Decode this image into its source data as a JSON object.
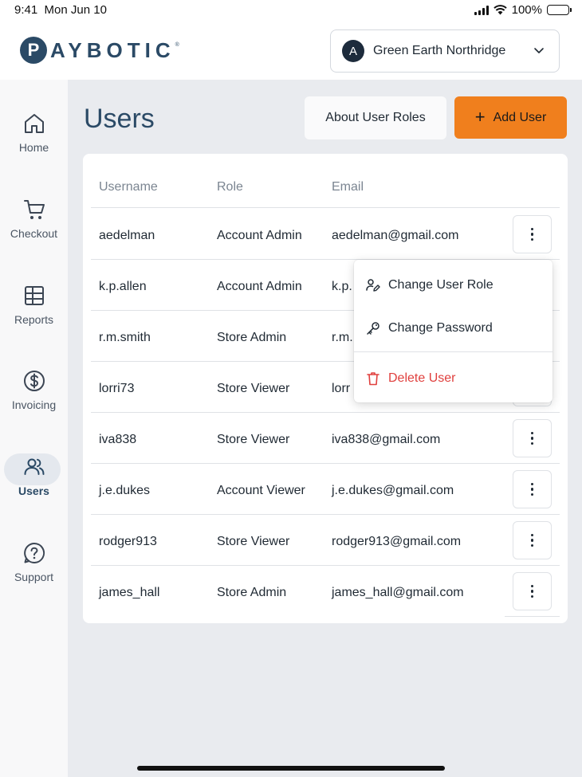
{
  "status_bar": {
    "time": "9:41",
    "date": "Mon Jun 10",
    "battery": "100%"
  },
  "brand": {
    "logo_letter": "P",
    "logo_text": "AYBOTIC",
    "logo_mark": "®",
    "color": "#2b4a66"
  },
  "store_selector": {
    "avatar_letter": "A",
    "store_name": "Green Earth Northridge"
  },
  "sidebar": {
    "items": [
      {
        "label": "Home",
        "icon": "home-icon"
      },
      {
        "label": "Checkout",
        "icon": "cart-icon"
      },
      {
        "label": "Reports",
        "icon": "table-icon"
      },
      {
        "label": "Invoicing",
        "icon": "dollar-circle-icon"
      },
      {
        "label": "Users",
        "icon": "users-icon",
        "active": true
      },
      {
        "label": "Support",
        "icon": "help-circle-icon"
      }
    ]
  },
  "page": {
    "title": "Users",
    "about_roles_label": "About User Roles",
    "add_user_label": "Add User",
    "accent_color": "#f07f1d"
  },
  "table": {
    "headers": {
      "username": "Username",
      "role": "Role",
      "email": "Email"
    },
    "rows": [
      {
        "username": "aedelman",
        "role": "Account Admin",
        "email": "aedelman@gmail.com"
      },
      {
        "username": "k.p.allen",
        "role": "Account Admin",
        "email": "k.p."
      },
      {
        "username": "r.m.smith",
        "role": "Store Admin",
        "email": "r.m."
      },
      {
        "username": "lorri73",
        "role": "Store Viewer",
        "email": "lorr"
      },
      {
        "username": "iva838",
        "role": "Store Viewer",
        "email": "iva838@gmail.com"
      },
      {
        "username": "j.e.dukes",
        "role": "Account Viewer",
        "email": "j.e.dukes@gmail.com"
      },
      {
        "username": "rodger913",
        "role": "Store Viewer",
        "email": "rodger913@gmail.com"
      },
      {
        "username": "james_hall",
        "role": "Store Admin",
        "email": "james_hall@gmail.com"
      }
    ]
  },
  "context_menu": {
    "change_role": "Change User Role",
    "change_password": "Change Password",
    "delete_user": "Delete User",
    "danger_color": "#e0403e"
  }
}
